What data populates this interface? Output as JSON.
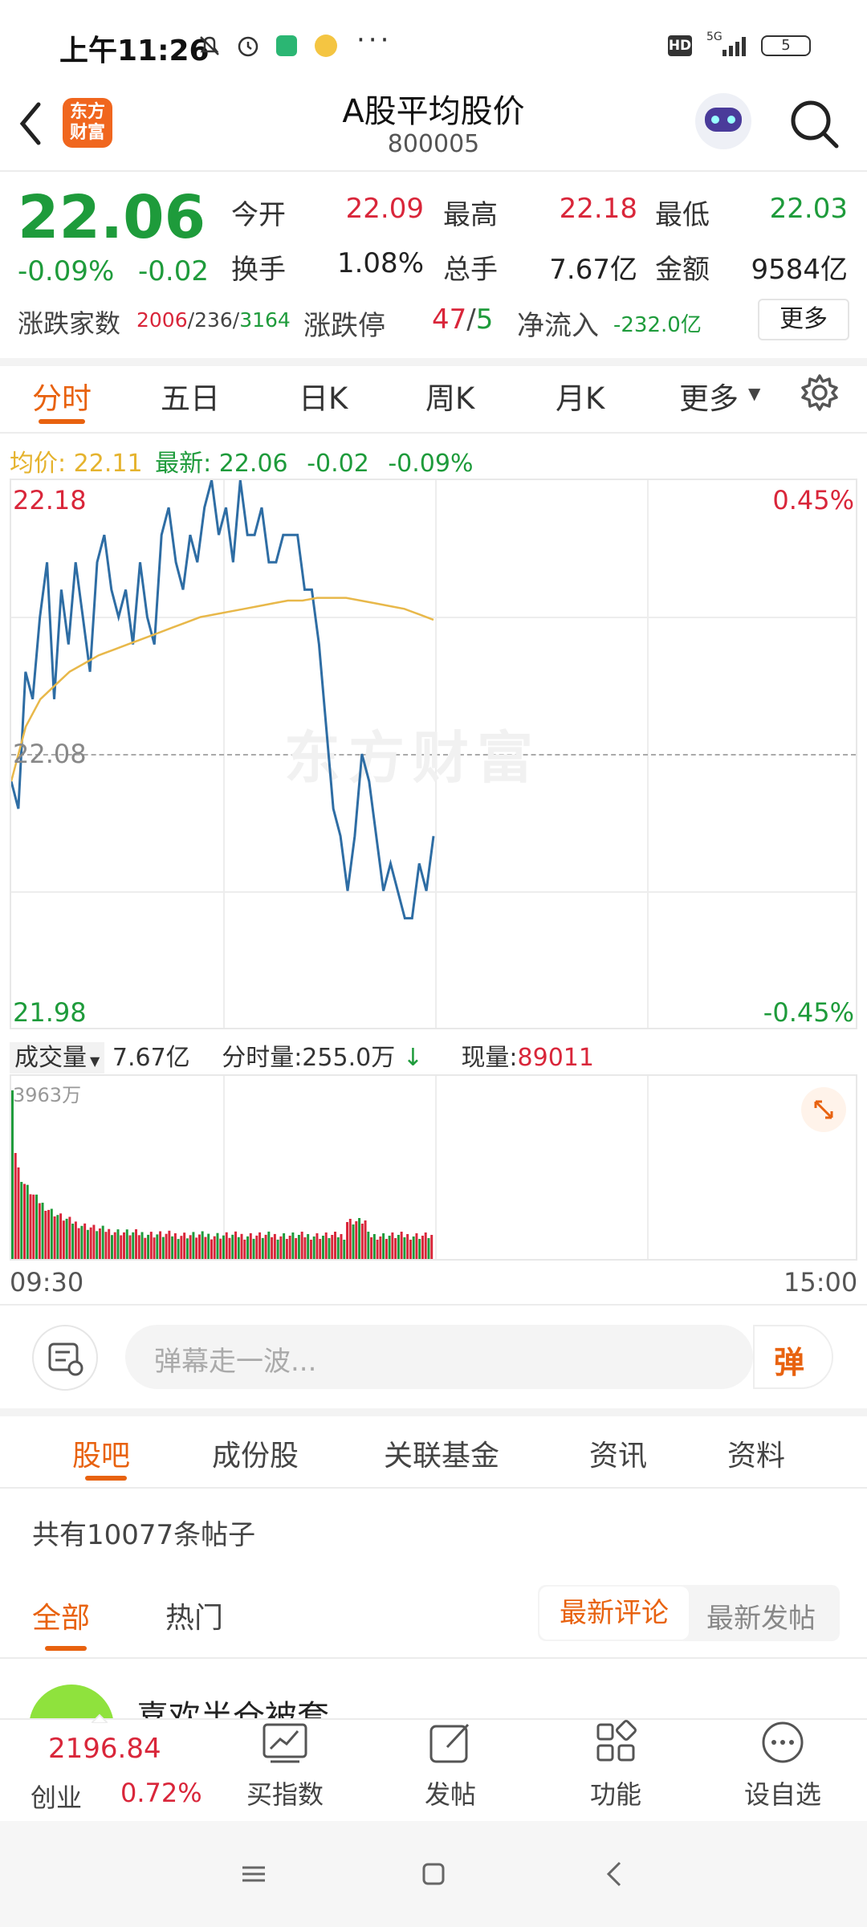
{
  "status_bar": {
    "time": "上午11:26",
    "network": "5G",
    "hd": "HD",
    "battery": "5"
  },
  "header": {
    "title": "A股平均股价",
    "code": "800005",
    "logo_text": "东方财富"
  },
  "quote": {
    "price": "22.06",
    "change_pct": "-0.09%",
    "change": "-0.02",
    "open_label": "今开",
    "open": "22.09",
    "high_label": "最高",
    "high": "22.18",
    "low_label": "最低",
    "low": "22.03",
    "turnover_label": "换手",
    "turnover": "1.08%",
    "volume_label": "总手",
    "volume": "7.67亿",
    "amount_label": "金额",
    "amount": "9584亿",
    "breadth_label": "涨跌家数",
    "breadth_up": "2006",
    "breadth_flat": "236",
    "breadth_down": "3164",
    "limit_label": "涨跌停",
    "limit_up": "47",
    "limit_down": "5",
    "netflow_label": "净流入",
    "netflow": "-232.0亿",
    "more_button": "更多"
  },
  "chart_tabs": [
    "分时",
    "五日",
    "日K",
    "周K",
    "月K",
    "更多"
  ],
  "legend": {
    "avg_label": "均价:",
    "avg_value": "22.11",
    "latest_label": "最新:",
    "latest_value": "22.06",
    "latest_change": "-0.02",
    "latest_pct": "-0.09%"
  },
  "chart_labels": {
    "top_price": "22.18",
    "mid_price": "22.08",
    "bottom_price": "21.98",
    "top_pct": "0.45%",
    "bottom_pct": "-0.45%",
    "watermark": "东方财富",
    "vol_title": "成交量",
    "vol_value": "7.67亿",
    "minute_vol": "分时量:255.0万",
    "current_vol_label": "现量:",
    "current_vol": "89011",
    "vol_max": "3963万",
    "time_start": "09:30",
    "time_end": "15:00"
  },
  "chart_data": {
    "type": "line",
    "ylim": [
      21.98,
      22.18
    ],
    "baseline": 22.08,
    "price": [
      22.07,
      22.06,
      22.11,
      22.1,
      22.13,
      22.15,
      22.1,
      22.14,
      22.12,
      22.15,
      22.13,
      22.11,
      22.15,
      22.16,
      22.14,
      22.13,
      22.14,
      22.12,
      22.15,
      22.13,
      22.12,
      22.16,
      22.17,
      22.15,
      22.14,
      22.16,
      22.15,
      22.17,
      22.18,
      22.16,
      22.17,
      22.15,
      22.18,
      22.16,
      22.16,
      22.17,
      22.15,
      22.15,
      22.16,
      22.16,
      22.16,
      22.14,
      22.14,
      22.12,
      22.09,
      22.06,
      22.05,
      22.03,
      22.05,
      22.08,
      22.07,
      22.05,
      22.03,
      22.04,
      22.03,
      22.02,
      22.02,
      22.04,
      22.03,
      22.05
    ],
    "avg": [
      22.07,
      22.09,
      22.1,
      22.105,
      22.11,
      22.113,
      22.116,
      22.118,
      22.12,
      22.122,
      22.124,
      22.126,
      22.128,
      22.13,
      22.131,
      22.132,
      22.133,
      22.134,
      22.135,
      22.136,
      22.136,
      22.137,
      22.137,
      22.137,
      22.136,
      22.135,
      22.134,
      22.133,
      22.131,
      22.129
    ],
    "volume_bars": 140,
    "volume_max": "3963万"
  },
  "danmu": {
    "placeholder": "弹幕走一波...",
    "button": "弹"
  },
  "content_tabs": [
    "股吧",
    "成份股",
    "关联基金",
    "资讯",
    "资料"
  ],
  "post_count": "共有10077条帖子",
  "filter": {
    "all": "全部",
    "hot": "热门",
    "latest_comment": "最新评论",
    "latest_post": "最新发帖"
  },
  "first_post_author": "喜欢半仓被套",
  "bottom_nav": {
    "index_value": "2196.84",
    "index_name": "创业",
    "index_pct": "0.72%",
    "items": [
      "买指数",
      "发帖",
      "功能",
      "设自选"
    ]
  },
  "colors": {
    "up": "#d9263a",
    "down": "#1e9b3b",
    "accent": "#f0661e",
    "line": "#2e6da4",
    "avg": "#e8b84a"
  }
}
